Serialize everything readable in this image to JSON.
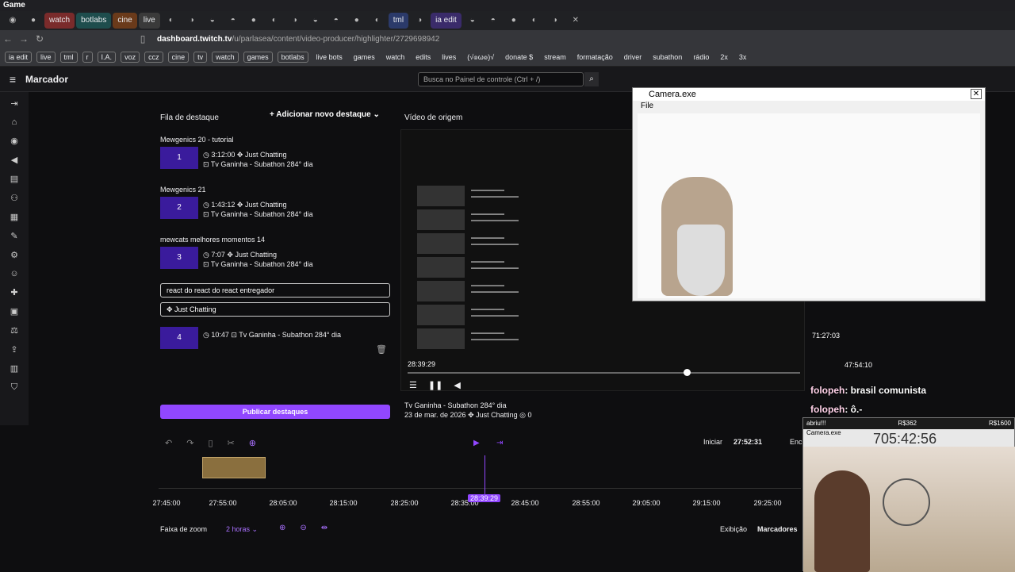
{
  "window": {
    "title": "Game"
  },
  "tabs": [
    "watch",
    "botlabs",
    "cine",
    "live",
    "tml",
    "ia edit"
  ],
  "browser": {
    "url_host": "dashboard.twitch.tv",
    "url_path": "/u/parlasea/content/video-producer/highlighter/2729698942"
  },
  "bookmarks": [
    "ia edit",
    "live",
    "tml",
    "r",
    "I.A.",
    "voz",
    "ccz",
    "cine",
    "tv",
    "watch",
    "games",
    "botlabs",
    "live bots",
    "games",
    "watch",
    "edits",
    "lives",
    "(√๏ω๏)√",
    "donate $",
    "stream",
    "formatação",
    "driver",
    "subathon",
    "rádio",
    "2x",
    "3x"
  ],
  "header": {
    "page_title": "Marcador",
    "search_placeholder": "Busca no Painel de controle (Ctrl + /)"
  },
  "queue": {
    "title": "Fila de destaque",
    "add_label": "Adicionar novo destaque",
    "items": [
      {
        "title": "Mewgenics 20 - tutorial",
        "num": "1",
        "duration": "3:12:00",
        "category": "Just Chatting",
        "source": "Tv Ganinha - Subathon 284° dia"
      },
      {
        "title": "Mewgenics 21",
        "num": "2",
        "duration": "1:43:12",
        "category": "Just Chatting",
        "source": "Tv Ganinha - Subathon 284° dia"
      },
      {
        "title": "mewcats melhores momentos 14",
        "num": "3",
        "duration": "7:07",
        "category": "Just Chatting",
        "source": "Tv Ganinha - Subathon 284° dia"
      }
    ],
    "editing": {
      "title_value": "react do react do react entregador",
      "category_value": "Just Chatting",
      "num": "4",
      "duration": "10:47",
      "source": "Tv Ganinha - Subathon 284° dia"
    },
    "publish_label": "Publicar destaques"
  },
  "source_video": {
    "title": "Vídeo de origem",
    "time": "28:39:29",
    "info_title": "Tv Ganinha - Subathon 284° dia",
    "info_date": "23 de mar. de 2026",
    "info_category": "Just Chatting",
    "info_views": "0"
  },
  "camera": {
    "title": "Camera.exe",
    "menu_file": "File"
  },
  "timeline": {
    "start_label": "Iniciar",
    "start_time": "27:52:31",
    "end_label": "Enc",
    "playhead": "28:39:29",
    "ticks": [
      "27:45:00",
      "27:55:00",
      "28:05:00",
      "28:15:00",
      "28:25:00",
      "28:35:00",
      "28:45:00",
      "28:55:00",
      "29:05:00",
      "29:15:00",
      "29:25:00"
    ],
    "zoom_label": "Faixa de zoom",
    "zoom_value": "2 horas",
    "view_label": "Exibição",
    "markers_label": "Marcadores"
  },
  "chat": [
    {
      "user": "folopeh",
      "msg": ": brasil comunista"
    },
    {
      "user": "folopeh",
      "msg": ": ô.-"
    }
  ],
  "cam2": {
    "left": "abriu!!!",
    "mid": "R$362",
    "right": "R$1600",
    "title": "Camera.exe",
    "time": "705:42:56"
  },
  "overlay": {
    "time1": "71:27:03",
    "time2": "47:54:10"
  }
}
